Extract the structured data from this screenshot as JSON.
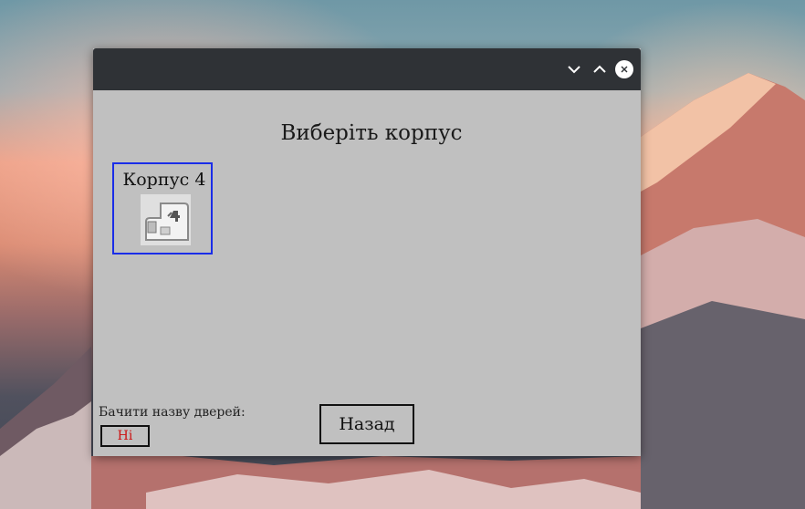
{
  "window": {
    "heading": "Виберіть корпус"
  },
  "buildings": [
    {
      "label": "Корпус 4",
      "image_icon": "building-plan-icon"
    }
  ],
  "door_names": {
    "label": "Бачити назву дверей:",
    "toggle_value": "Ні",
    "toggle_color": "#cc1111"
  },
  "back_button": {
    "label": "Назад"
  },
  "icons": {
    "minimize": "chevron-down-icon",
    "maximize": "chevron-up-icon",
    "close": "close-icon"
  }
}
